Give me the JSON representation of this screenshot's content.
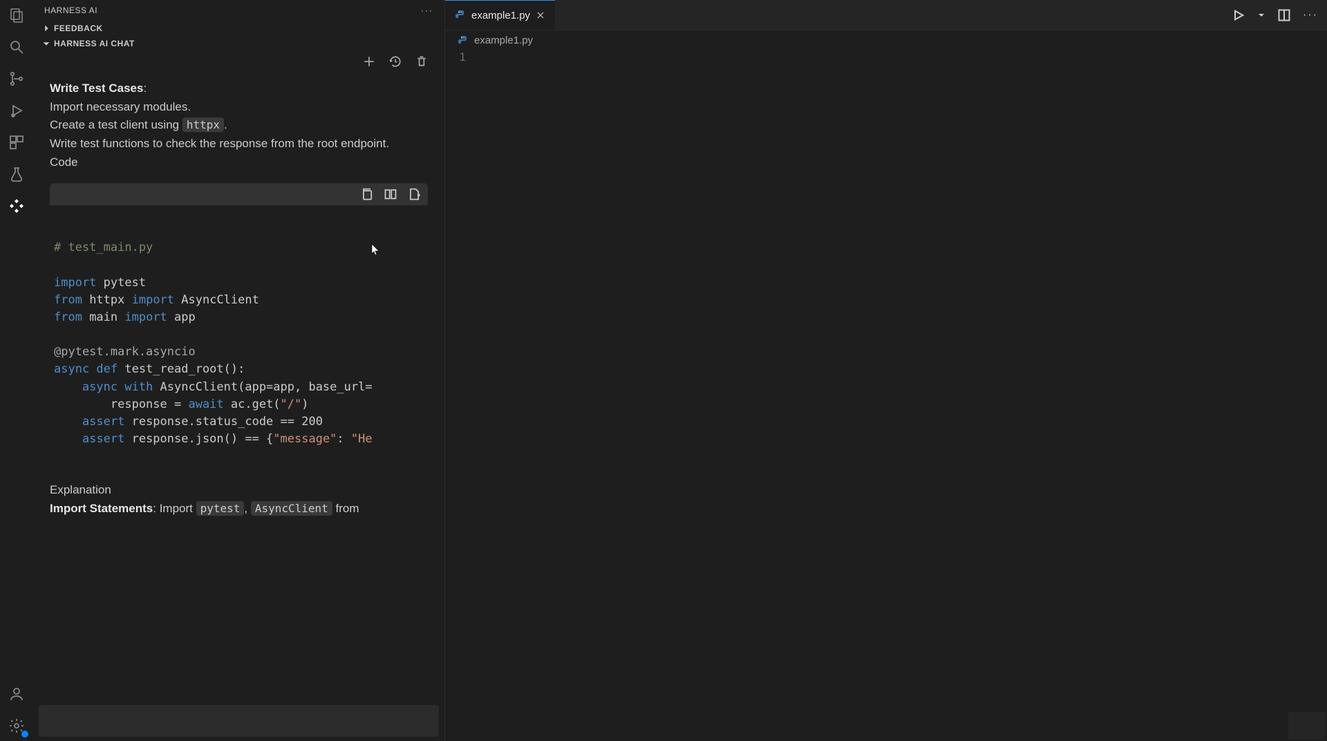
{
  "sidebar": {
    "title": "HARNESS AI",
    "section_feedback": "FEEDBACK",
    "section_chat": "HARNESS AI CHAT"
  },
  "chat": {
    "heading": "Write Test Cases",
    "heading_colon": ":",
    "line1": "Import necessary modules.",
    "line2a": "Create a test client using ",
    "line2_code": "httpx",
    "line2b": ".",
    "line3": "Write test functions to check the response from the root endpoint.",
    "line4": "Code",
    "explanation_heading": "Explanation",
    "exp_line_a": "Import Statements",
    "exp_line_b": ": Import ",
    "exp_code1": "pytest",
    "exp_sep": ", ",
    "exp_code2": "AsyncClient",
    "exp_tail": " from"
  },
  "code": {
    "c0": "# test_main.py",
    "blank": "",
    "c1a": "import",
    "c1b": " pytest",
    "c2a": "from",
    "c2b": " httpx ",
    "c2c": "import",
    "c2d": " AsyncClient",
    "c3a": "from",
    "c3b": " main ",
    "c3c": "import",
    "c3d": " app",
    "c4": "@pytest.mark.asyncio",
    "c5a": "async def",
    "c5b": " test_read_root():",
    "c6a": "    async with",
    "c6b": " AsyncClient(app=app, base_url=",
    "c7a": "        response = ",
    "c7b": "await",
    "c7c": " ac.get(",
    "c7d": "\"/\"",
    "c7e": ")",
    "c8a": "    assert",
    "c8b": " response.status_code == 200",
    "c9a": "    assert",
    "c9b": " response.json() == {",
    "c9c": "\"message\"",
    "c9d": ": ",
    "c9e": "\"He"
  },
  "editor": {
    "tab_name": "example1.py",
    "breadcrumb": "example1.py",
    "line_1": "1"
  }
}
